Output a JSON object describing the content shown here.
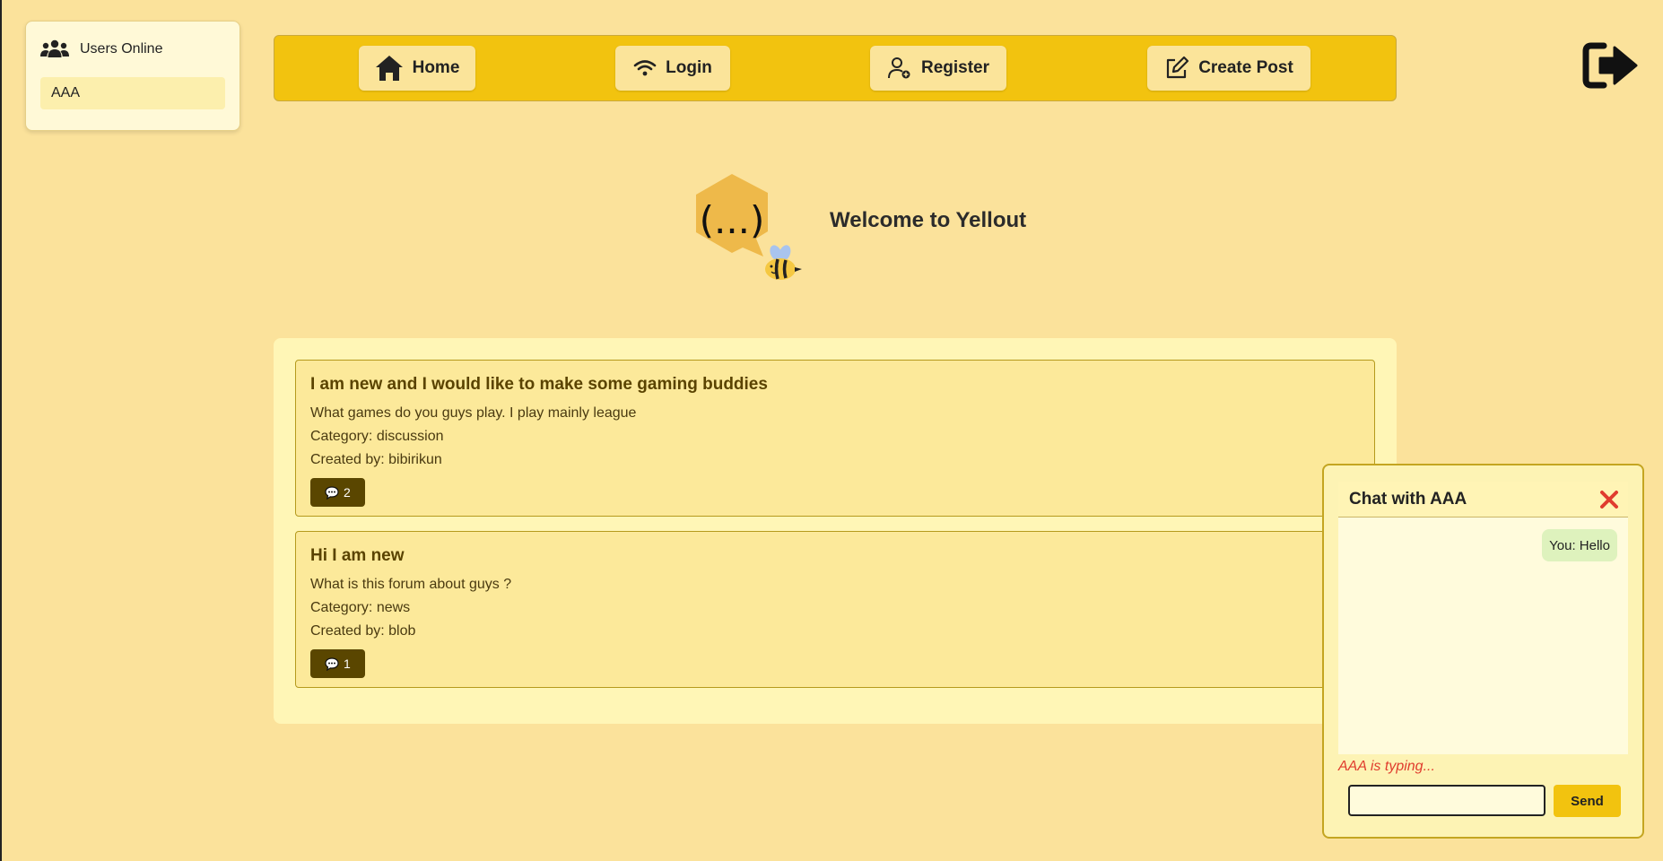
{
  "users_panel": {
    "title": "Users Online",
    "icon": "users-icon",
    "users": [
      "AAA"
    ]
  },
  "navbar": {
    "home": {
      "label": "Home",
      "icon": "home-icon"
    },
    "login": {
      "label": "Login",
      "icon": "wifi-icon"
    },
    "register": {
      "label": "Register",
      "icon": "user-add-icon"
    },
    "create_post": {
      "label": "Create Post",
      "icon": "edit-icon"
    },
    "logout_icon": "logout-icon"
  },
  "hero": {
    "logo_text": "(...)",
    "welcome": "Welcome to Yellout"
  },
  "posts": [
    {
      "title": "I am new and I would like to make some gaming buddies",
      "body": "What games do you guys play. I play mainly league",
      "category": "Category: discussion",
      "author": "Created by: bibirikun",
      "comments": "2"
    },
    {
      "title": "Hi I am new",
      "body": "What is this forum about guys ?",
      "category": "Category: news",
      "author": "Created by: blob",
      "comments": "1"
    }
  ],
  "chat": {
    "title": "Chat with AAA",
    "messages": [
      {
        "from": "self",
        "text": "You: Hello"
      }
    ],
    "typing": "AAA is typing...",
    "input_value": "",
    "send_label": "Send"
  },
  "colors": {
    "background": "#fbe29b",
    "navbar": "#f2c30f",
    "accent_dark": "#5a4600",
    "typing_red": "#e03c2e"
  }
}
